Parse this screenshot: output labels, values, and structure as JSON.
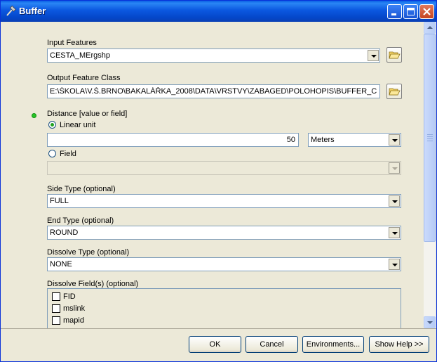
{
  "window": {
    "title": "Buffer"
  },
  "input_features": {
    "label": "Input Features",
    "value": "CESTA_MErgshp"
  },
  "output_feature_class": {
    "label": "Output Feature Class",
    "value": "E:\\ŠKOLA\\V.Š.BRNO\\BAKALÁŘKA_2008\\DATA\\VRSTVY\\ZABAGED\\POLOHOPIS\\BUFFER_CESTA.s"
  },
  "distance": {
    "label": "Distance [value or field]",
    "linear_unit_label": "Linear unit",
    "value": "50",
    "unit": "Meters",
    "field_label": "Field",
    "field_value": ""
  },
  "side_type": {
    "label": "Side Type (optional)",
    "value": "FULL"
  },
  "end_type": {
    "label": "End Type (optional)",
    "value": "ROUND"
  },
  "dissolve_type": {
    "label": "Dissolve Type (optional)",
    "value": "NONE"
  },
  "dissolve_fields": {
    "label": "Dissolve Field(s) (optional)",
    "items": [
      {
        "label": "FID"
      },
      {
        "label": "mslink"
      },
      {
        "label": "mapid"
      }
    ]
  },
  "buttons": {
    "ok": "OK",
    "cancel": "Cancel",
    "environments": "Environments...",
    "show_help": "Show Help >>"
  },
  "colors": {
    "title_bar": "#0a5fe3",
    "dialog_bg": "#ece9d8",
    "valid_dot": "#27c427"
  }
}
